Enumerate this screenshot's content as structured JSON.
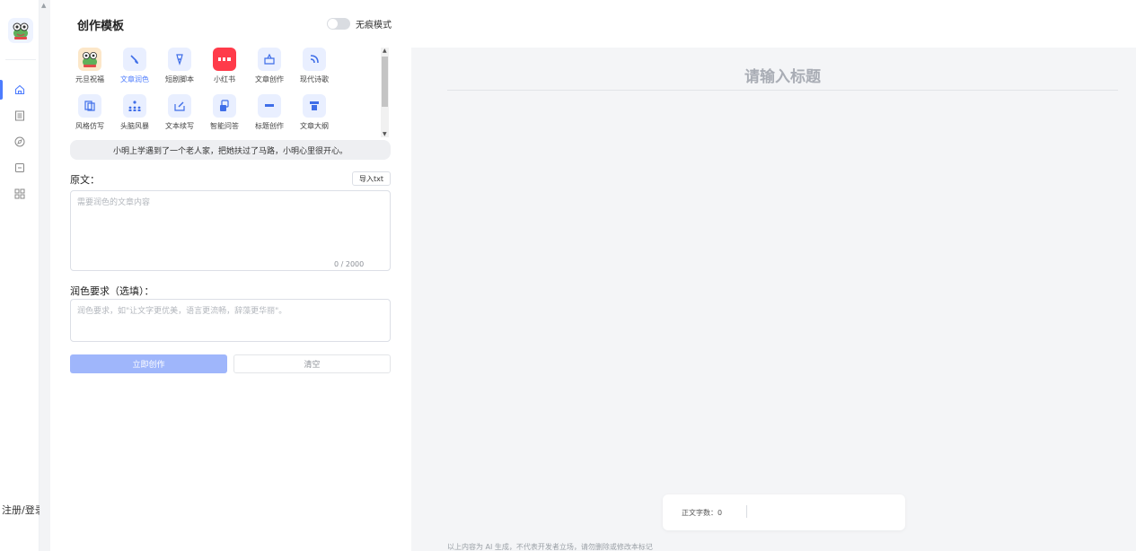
{
  "sidebar": {
    "login_label": "注册/登录",
    "nav_items": [
      {
        "name": "home",
        "icon": "home-icon",
        "active": true
      },
      {
        "name": "document",
        "icon": "document-list-icon",
        "active": false
      },
      {
        "name": "compass",
        "icon": "compass-icon",
        "active": false
      },
      {
        "name": "box",
        "icon": "box-icon",
        "active": false
      },
      {
        "name": "apps",
        "icon": "apps-grid-icon",
        "active": false
      }
    ]
  },
  "panel": {
    "title": "创作模板",
    "toggle_label": "无痕模式",
    "templates": [
      {
        "label": "元旦祝福",
        "icon": "frog-mascot-icon",
        "active": false
      },
      {
        "label": "文章润色",
        "icon": "brush-icon",
        "active": true
      },
      {
        "label": "短剧脚本",
        "icon": "pen-nib-icon",
        "active": false
      },
      {
        "label": "小红书",
        "icon": "xiaohongshu-logo-icon",
        "active": false
      },
      {
        "label": "文章创作",
        "icon": "box-pen-icon",
        "active": false
      },
      {
        "label": "现代诗歌",
        "icon": "signal-icon",
        "active": false
      },
      {
        "label": "风格仿写",
        "icon": "copy-icon",
        "active": false
      },
      {
        "label": "头脑风暴",
        "icon": "people-icon",
        "active": false
      },
      {
        "label": "文本续写",
        "icon": "edit-box-icon",
        "active": false
      },
      {
        "label": "智能问答",
        "icon": "qa-icon",
        "active": false
      },
      {
        "label": "标题创作",
        "icon": "title-bar-icon",
        "active": false
      },
      {
        "label": "文章大纲",
        "icon": "outline-icon",
        "active": false
      }
    ],
    "example_text": "小明上学遇到了一个老人家，把她扶过了马路，小明心里很开心。",
    "source_label": "原文：",
    "import_label": "导入txt",
    "source_placeholder": "需要润色的文章内容",
    "source_count": "0 / 2000",
    "requirement_label": "润色要求（选填）：",
    "requirement_placeholder": "润色要求，如\"让文字更优美，语言更流畅，辞藻更华丽\"。",
    "submit_label": "立即创作",
    "clear_label": "清空"
  },
  "editor": {
    "title_placeholder": "请输入标题",
    "word_count_label": "正文字数：0",
    "disclaimer": "以上内容为 AI 生成，不代表开发者立场，请勿删除或修改本标记"
  },
  "colors": {
    "accent": "#4d7cfe",
    "submit_disabled": "#9fb6fb",
    "editor_bg": "#f4f5f7"
  }
}
